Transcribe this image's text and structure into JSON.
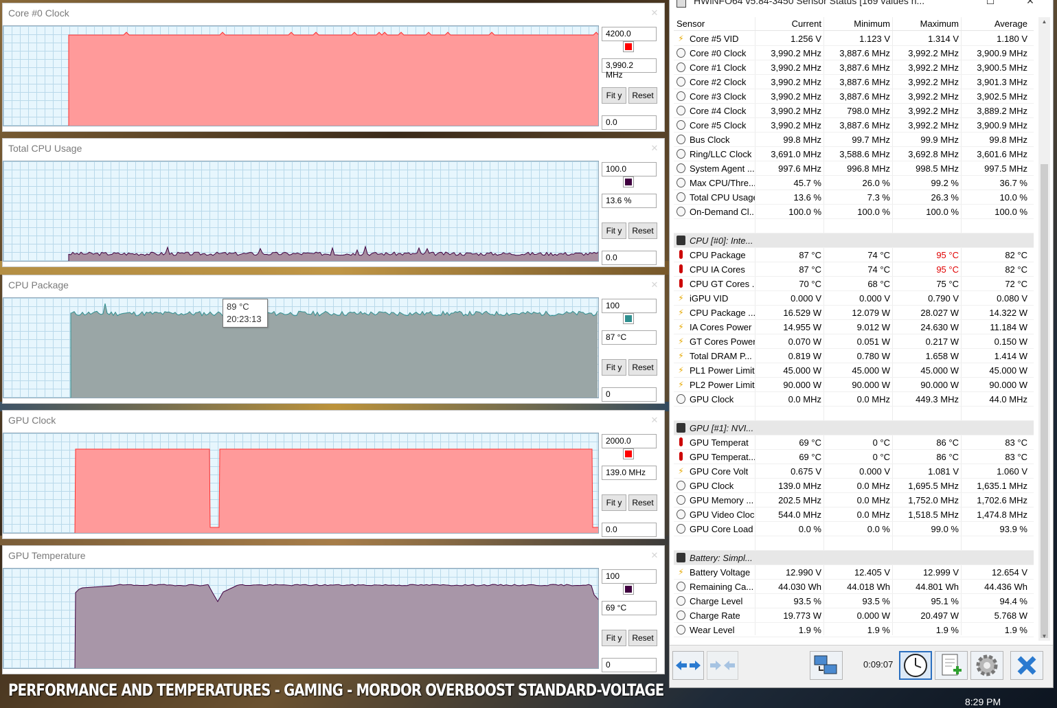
{
  "graphs": [
    {
      "title": "Core #0 Clock",
      "max": "4200.0",
      "current": "3,990.2 MHz",
      "min": "0.0",
      "color": "#ff0000",
      "fill": "#ff9a9a",
      "stroke": "#ff3030",
      "fit": "Fit y",
      "reset": "Reset"
    },
    {
      "title": "Total CPU Usage",
      "max": "100.0",
      "current": "13.6 %",
      "min": "0.0",
      "color": "#400040",
      "fill": "#a88ea0",
      "stroke": "#400040",
      "fit": "Fit y",
      "reset": "Reset"
    },
    {
      "title": "CPU Package",
      "max": "100",
      "current": "87 °C",
      "min": "0",
      "color": "#2f8f8f",
      "fill": "#9aa6a6",
      "stroke": "#2f8f8f",
      "fit": "Fit y",
      "reset": "Reset",
      "tooltip": {
        "value": "89 °C",
        "time": "20:23:13"
      }
    },
    {
      "title": "GPU Clock",
      "max": "2000.0",
      "current": "139.0 MHz",
      "min": "0.0",
      "color": "#ff0000",
      "fill": "#ff9a9a",
      "stroke": "#ff3030",
      "fit": "Fit y",
      "reset": "Reset"
    },
    {
      "title": "GPU Temperature",
      "max": "100",
      "current": "69 °C",
      "min": "0",
      "color": "#400040",
      "fill": "#a896a8",
      "stroke": "#400040",
      "fit": "Fit y",
      "reset": "Reset"
    }
  ],
  "sensor_window": {
    "title": "HWiNFO64 v5.84-3450 Sensor Status [169 values h...",
    "headers": [
      "Sensor",
      "Current",
      "Minimum",
      "Maximum",
      "Average"
    ],
    "rows": [
      {
        "icon": "volt",
        "name": "Core #5 VID",
        "cur": "1.256 V",
        "min": "1.123 V",
        "max": "1.314 V",
        "avg": "1.180 V"
      },
      {
        "icon": "clock",
        "name": "Core #0 Clock",
        "cur": "3,990.2 MHz",
        "min": "3,887.6 MHz",
        "max": "3,992.2 MHz",
        "avg": "3,900.9 MHz"
      },
      {
        "icon": "clock",
        "name": "Core #1 Clock",
        "cur": "3,990.2 MHz",
        "min": "3,887.6 MHz",
        "max": "3,992.2 MHz",
        "avg": "3,900.5 MHz"
      },
      {
        "icon": "clock",
        "name": "Core #2 Clock",
        "cur": "3,990.2 MHz",
        "min": "3,887.6 MHz",
        "max": "3,992.2 MHz",
        "avg": "3,901.3 MHz"
      },
      {
        "icon": "clock",
        "name": "Core #3 Clock",
        "cur": "3,990.2 MHz",
        "min": "3,887.6 MHz",
        "max": "3,992.2 MHz",
        "avg": "3,902.5 MHz"
      },
      {
        "icon": "clock",
        "name": "Core #4 Clock",
        "cur": "3,990.2 MHz",
        "min": "798.0 MHz",
        "max": "3,992.2 MHz",
        "avg": "3,889.2 MHz"
      },
      {
        "icon": "clock",
        "name": "Core #5 Clock",
        "cur": "3,990.2 MHz",
        "min": "3,887.6 MHz",
        "max": "3,992.2 MHz",
        "avg": "3,900.9 MHz"
      },
      {
        "icon": "clock",
        "name": "Bus Clock",
        "cur": "99.8 MHz",
        "min": "99.7 MHz",
        "max": "99.9 MHz",
        "avg": "99.8 MHz"
      },
      {
        "icon": "clock",
        "name": "Ring/LLC Clock",
        "cur": "3,691.0 MHz",
        "min": "3,588.6 MHz",
        "max": "3,692.8 MHz",
        "avg": "3,601.6 MHz"
      },
      {
        "icon": "clock",
        "name": "System Agent ...",
        "cur": "997.6 MHz",
        "min": "996.8 MHz",
        "max": "998.5 MHz",
        "avg": "997.5 MHz"
      },
      {
        "icon": "clock",
        "name": "Max CPU/Thre...",
        "cur": "45.7 %",
        "min": "26.0 %",
        "max": "99.2 %",
        "avg": "36.7 %"
      },
      {
        "icon": "clock",
        "name": "Total CPU Usage",
        "cur": "13.6 %",
        "min": "7.3 %",
        "max": "26.3 %",
        "avg": "10.0 %"
      },
      {
        "icon": "clock",
        "name": "On-Demand Cl...",
        "cur": "100.0 %",
        "min": "100.0 %",
        "max": "100.0 %",
        "avg": "100.0 %"
      },
      {
        "type": "blank"
      },
      {
        "type": "group",
        "icon": "chip",
        "name": "CPU [#0]: Inte..."
      },
      {
        "icon": "temp",
        "name": "CPU Package",
        "cur": "87 °C",
        "min": "74 °C",
        "max": "95 °C",
        "avg": "82 °C",
        "max_red": true
      },
      {
        "icon": "temp",
        "name": "CPU IA Cores",
        "cur": "87 °C",
        "min": "74 °C",
        "max": "95 °C",
        "avg": "82 °C",
        "max_red": true
      },
      {
        "icon": "temp",
        "name": "CPU GT Cores ...",
        "cur": "70 °C",
        "min": "68 °C",
        "max": "75 °C",
        "avg": "72 °C"
      },
      {
        "icon": "volt",
        "name": "iGPU VID",
        "cur": "0.000 V",
        "min": "0.000 V",
        "max": "0.790 V",
        "avg": "0.080 V"
      },
      {
        "icon": "volt",
        "name": "CPU Package ...",
        "cur": "16.529 W",
        "min": "12.079 W",
        "max": "28.027 W",
        "avg": "14.322 W"
      },
      {
        "icon": "volt",
        "name": "IA Cores Power",
        "cur": "14.955 W",
        "min": "9.012 W",
        "max": "24.630 W",
        "avg": "11.184 W"
      },
      {
        "icon": "volt",
        "name": "GT Cores Power",
        "cur": "0.070 W",
        "min": "0.051 W",
        "max": "0.217 W",
        "avg": "0.150 W"
      },
      {
        "icon": "volt",
        "name": "Total DRAM P...",
        "cur": "0.819 W",
        "min": "0.780 W",
        "max": "1.658 W",
        "avg": "1.414 W"
      },
      {
        "icon": "volt",
        "name": "PL1 Power Limit",
        "cur": "45.000 W",
        "min": "45.000 W",
        "max": "45.000 W",
        "avg": "45.000 W"
      },
      {
        "icon": "volt",
        "name": "PL2 Power Limit",
        "cur": "90.000 W",
        "min": "90.000 W",
        "max": "90.000 W",
        "avg": "90.000 W"
      },
      {
        "icon": "clock",
        "name": "GPU Clock",
        "cur": "0.0 MHz",
        "min": "0.0 MHz",
        "max": "449.3 MHz",
        "avg": "44.0 MHz"
      },
      {
        "type": "blank"
      },
      {
        "type": "group",
        "icon": "chip",
        "name": "GPU [#1]: NVI..."
      },
      {
        "icon": "temp",
        "name": "GPU Temperat",
        "cur": "69 °C",
        "min": "0 °C",
        "max": "86 °C",
        "avg": "83 °C"
      },
      {
        "icon": "temp",
        "name": "GPU Temperat...",
        "cur": "69 °C",
        "min": "0 °C",
        "max": "86 °C",
        "avg": "83 °C"
      },
      {
        "icon": "volt",
        "name": "GPU Core Volt",
        "cur": "0.675 V",
        "min": "0.000 V",
        "max": "1.081 V",
        "avg": "1.060 V"
      },
      {
        "icon": "clock",
        "name": "GPU Clock",
        "cur": "139.0 MHz",
        "min": "0.0 MHz",
        "max": "1,695.5 MHz",
        "avg": "1,635.1 MHz"
      },
      {
        "icon": "clock",
        "name": "GPU Memory ...",
        "cur": "202.5 MHz",
        "min": "0.0 MHz",
        "max": "1,752.0 MHz",
        "avg": "1,702.6 MHz"
      },
      {
        "icon": "clock",
        "name": "GPU Video Clock",
        "cur": "544.0 MHz",
        "min": "0.0 MHz",
        "max": "1,518.5 MHz",
        "avg": "1,474.8 MHz"
      },
      {
        "icon": "clock",
        "name": "GPU Core Load",
        "cur": "0.0 %",
        "min": "0.0 %",
        "max": "99.0 %",
        "avg": "93.9 %"
      },
      {
        "type": "blank"
      },
      {
        "type": "group",
        "icon": "chip",
        "name": "Battery: Simpl..."
      },
      {
        "icon": "volt",
        "name": "Battery Voltage",
        "cur": "12.990 V",
        "min": "12.405 V",
        "max": "12.999 V",
        "avg": "12.654 V"
      },
      {
        "icon": "clock",
        "name": "Remaining Ca...",
        "cur": "44.030 Wh",
        "min": "44.018 Wh",
        "max": "44.801 Wh",
        "avg": "44.436 Wh"
      },
      {
        "icon": "clock",
        "name": "Charge Level",
        "cur": "93.5 %",
        "min": "93.5 %",
        "max": "95.1 %",
        "avg": "94.4 %"
      },
      {
        "icon": "clock",
        "name": "Charge Rate",
        "cur": "19.773 W",
        "min": "0.000 W",
        "max": "20.497 W",
        "avg": "5.768 W"
      },
      {
        "icon": "clock",
        "name": "Wear Level",
        "cur": "1.9 %",
        "min": "1.9 %",
        "max": "1.9 %",
        "avg": "1.9 %"
      }
    ],
    "elapsed": "0:09:07"
  },
  "caption": "PERFORMANCE AND TEMPERATURES - GAMING - MORDOR OVERBOOST STANDARD-VOLTAGE",
  "clock": "8:29 PM"
}
